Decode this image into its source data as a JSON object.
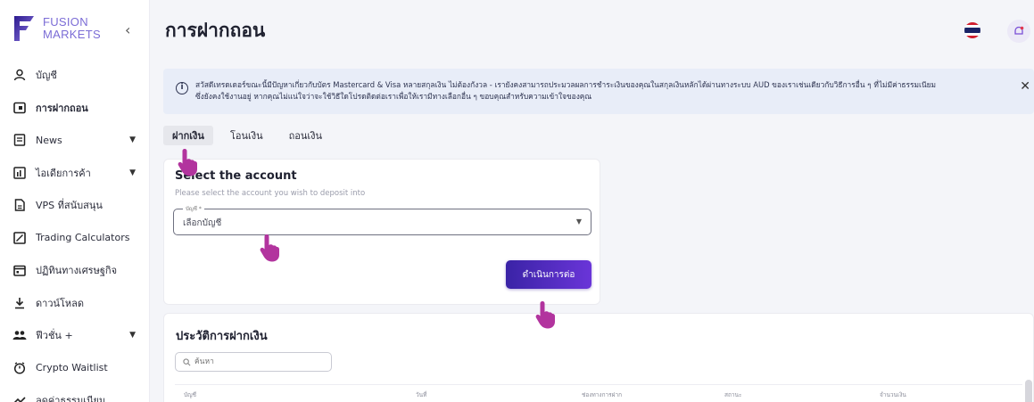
{
  "brand": {
    "line1": "FUSION",
    "line2": "MARKETS"
  },
  "sidebar": {
    "collapse_glyph": "‹",
    "items": [
      {
        "label": "บัญชี",
        "icon": "user-icon"
      },
      {
        "label": "การฝากถอน",
        "icon": "wallet-icon"
      },
      {
        "label": "News",
        "icon": "news-icon"
      },
      {
        "label": "ไอเดียการค้า",
        "icon": "chart-icon"
      },
      {
        "label": "VPS ที่สนับสนุน",
        "icon": "document-icon"
      },
      {
        "label": "Trading Calculators",
        "icon": "calculator-icon"
      },
      {
        "label": "ปฏิทินทางเศรษฐกิจ",
        "icon": "calendar-icon"
      },
      {
        "label": "ดาวน์โหลด",
        "icon": "download-icon"
      },
      {
        "label": "ฟีวชั่น +",
        "icon": "group-icon"
      },
      {
        "label": "Crypto Waitlist",
        "icon": "timer-icon"
      },
      {
        "label": "ลดค่าธรรมเนียม",
        "icon": "discount-icon"
      }
    ]
  },
  "header": {
    "title": "การฝากถอน"
  },
  "notice": {
    "line1": "สวัสดีเทรดเดอร์ขณะนี้มีปัญหาเกี่ยวกับบัตร Mastercard & Visa หลายสกุลเงิน ไม่ต้องกังวล - เรายังคงสามารถประมวลผลการชำระเงินของคุณในสกุลเงินหลักได้ผ่านทางระบบ AUD ของเราเช่นเดียวกับวิธีการอื่น ๆ ที่ไม่มีค่าธรรมเนียม",
    "line2": "ซึ่งยังคงใช้งานอยู่ หากคุณไม่แน่ใจว่าจะใช้วิธีใดโปรดติดต่อเราเพื่อให้เรามีทางเลือกอื่น ๆ ขอบคุณสำหรับความเข้าใจของคุณ",
    "close_glyph": "✕",
    "info_glyph": "i"
  },
  "tabs": [
    {
      "label": "ฝากเงิน",
      "active": true
    },
    {
      "label": "โอนเงิน",
      "active": false
    },
    {
      "label": "ถอนเงิน",
      "active": false
    }
  ],
  "deposit_card": {
    "title": "Select the account",
    "subtitle": "Please select the account you wish to deposit into",
    "select_legend": "บัญชี *",
    "select_value": "เลือกบัญชี",
    "select_chevron": "▼",
    "proceed_label": "ดำเนินการต่อ"
  },
  "history": {
    "title": "ประวัติการฝากเงิน",
    "search_placeholder": "ค้นหา",
    "columns": [
      "บัญชี",
      "วันที่",
      "ช่องทางการฝาก",
      "สถานะ",
      "จำนวนเงิน"
    ]
  },
  "colors": {
    "accent": "#5b2fd0",
    "pointer": "#b2349e",
    "brand": "#7b6cd6"
  }
}
